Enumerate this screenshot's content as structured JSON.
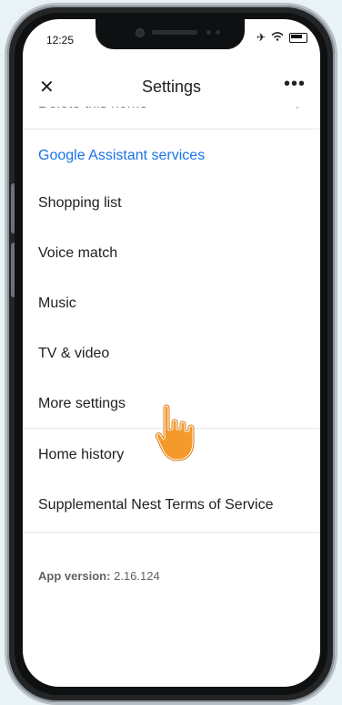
{
  "status_bar": {
    "time": "12:25",
    "airplane_icon": "airplane-icon",
    "wifi_icon": "wifi-icon",
    "battery_icon": "battery-icon"
  },
  "app_bar": {
    "title": "Settings",
    "close_icon": "close-icon",
    "more_icon": "more-icon"
  },
  "cut_item": {
    "label": "Delete this home",
    "chevron_icon": "chevron-right-icon"
  },
  "section": {
    "title": "Google Assistant services"
  },
  "items": [
    {
      "label": "Shopping list"
    },
    {
      "label": "Voice match"
    },
    {
      "label": "Music"
    },
    {
      "label": "TV & video"
    },
    {
      "label": "More settings"
    },
    {
      "label": "Home history"
    },
    {
      "label": "Supplemental Nest Terms of Service"
    }
  ],
  "app_version": {
    "label": "App version:",
    "value": "2.16.124"
  },
  "colors": {
    "accent": "#1a73e8",
    "hand_fill": "#f39a2a"
  },
  "pointer": {
    "icon": "hand-pointer-icon"
  }
}
